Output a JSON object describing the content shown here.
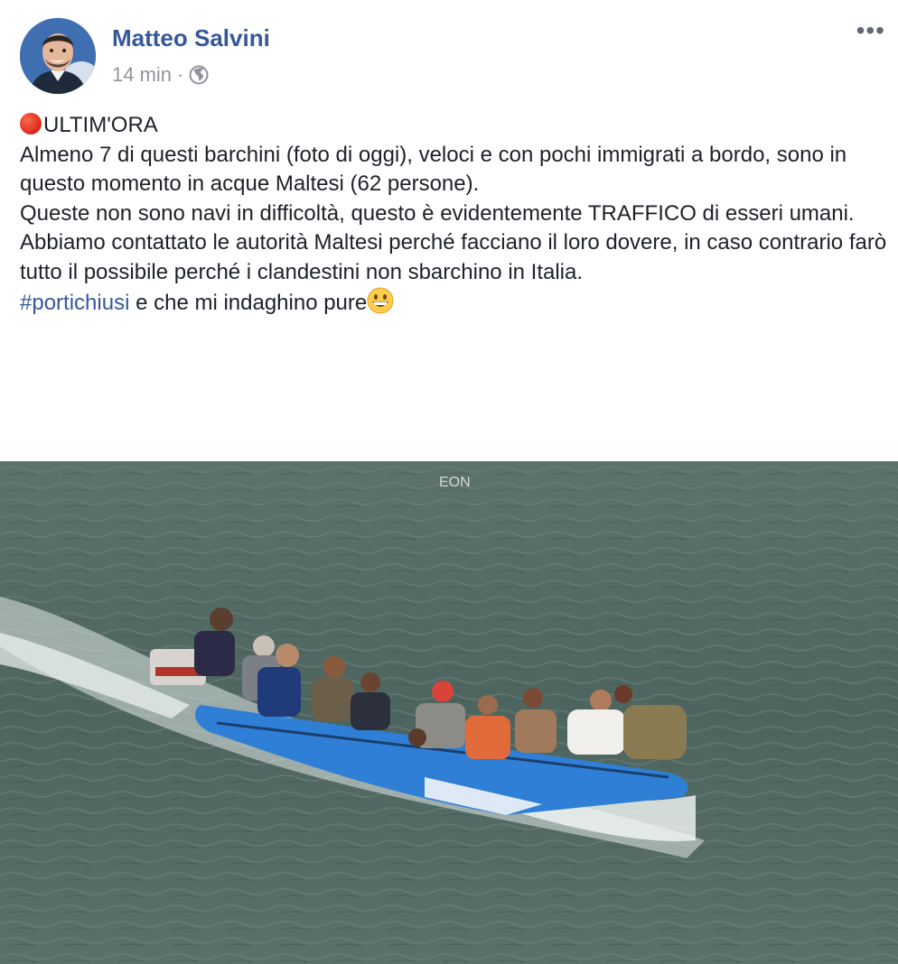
{
  "post": {
    "author": "Matteo Salvini",
    "time": "14 min",
    "separator": "·",
    "privacy_icon": "globe-icon",
    "more_icon": "more-dots-icon",
    "more_label": "•••"
  },
  "content": {
    "headline": "ULTIM'ORA",
    "headline_icon": "red-circle-icon",
    "line1": "Almeno 7 di questi barchini (foto di oggi), veloci e con pochi immigrati a bordo, sono in questo momento in acque Maltesi (62 persone).",
    "line2": "Queste non sono navi in difficoltà, questo è evidentemente TRAFFICO di esseri umani.",
    "line3": "Abbiamo contattato le autorità Maltesi perché facciano il loro dovere, in caso contrario farò tutto il possibile perché i clandestini non sbarchino in Italia.",
    "hashtag": "#portichiusi",
    "closing": " e che mi indaghino pure",
    "closing_emoji": "grinning-face-icon"
  },
  "photo": {
    "overlay_text": "EON",
    "subject": "boat-with-migrants-image"
  },
  "colors": {
    "link": "#365899",
    "text": "#1d2129",
    "meta": "#90949c",
    "sea": "#546b65",
    "boat": "#2f7fd6"
  }
}
